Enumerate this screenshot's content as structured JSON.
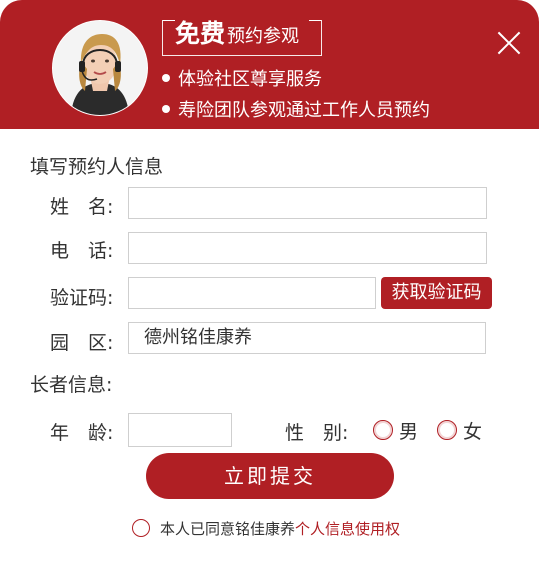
{
  "header": {
    "title_big": "免费",
    "title_small": "预约参观",
    "bullets": [
      "体验社区尊享服务",
      "寿险团队参观通过工作人员预约"
    ]
  },
  "form": {
    "section_booker": "填写预约人信息",
    "name_label": "姓　名:",
    "phone_label": "电　话:",
    "code_label": "验证码:",
    "get_code_button": "获取验证码",
    "park_label": "园　区:",
    "park_value": "德州铭佳康养",
    "section_elder": "长者信息:",
    "age_label": "年　龄:",
    "gender_label": "性　别:",
    "gender_options": [
      "男",
      "女"
    ],
    "submit_label": "立即提交",
    "agree_text": "本人已同意铭佳康养",
    "agree_link": "个人信息使用权"
  },
  "colors": {
    "brand": "#b01f24"
  }
}
